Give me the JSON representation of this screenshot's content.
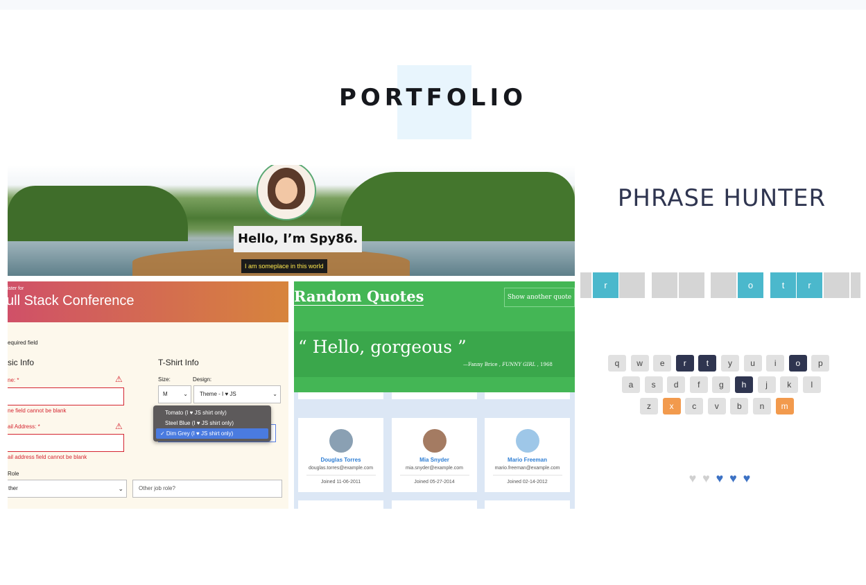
{
  "page": {
    "title": "PORTFOLIO"
  },
  "hero": {
    "greeting": "Hello, I’m Spy86.",
    "tagline": "I am someplace in this world"
  },
  "conference": {
    "register_for": "ister for",
    "name": "ull Stack Conference",
    "required_note": "equired field",
    "basic_info": "sic Info",
    "tshirt_info": "T-Shirt Info",
    "name_label": "ne: *",
    "name_error": "ne field cannot be blank",
    "email_label": "ail Address: *",
    "email_error": "ail address field cannot be blank",
    "role_label": "Role",
    "role_value": "ther",
    "other_role_placeholder": "Other job role?",
    "size_label": "Size:",
    "size_value": "M",
    "design_label": "Design:",
    "design_value": "Theme - I ♥ JS",
    "color_options": [
      "Tomato (I ♥ JS shirt only)",
      "Steel Blue (I ♥ JS shirt only)",
      "✓ Dim Grey (I ♥ JS shirt only)"
    ],
    "selected_color_index": 2
  },
  "quotes": {
    "title": "Random Quotes",
    "button": "Show another quote",
    "quote": "“ Hello, gorgeous ”",
    "source": "—Fanny Brice ,",
    "citation": "FUNNY GIRL",
    "year": ", 1968"
  },
  "employees": [
    {
      "name": "Douglas Torres",
      "email": "douglas.torres@example.com",
      "joined": "Joined 11-06-2011"
    },
    {
      "name": "Mia Snyder",
      "email": "mia.snyder@example.com",
      "joined": "Joined 05-27-2014"
    },
    {
      "name": "Mario Freeman",
      "email": "mario.freeman@example.com",
      "joined": "Joined 02-14-2012"
    }
  ],
  "phrase_hunter": {
    "title": "PHRASE HUNTER",
    "tiles": [
      "",
      "r",
      "",
      "",
      "",
      "",
      "o",
      "t",
      "r",
      "",
      ""
    ],
    "keyboard_rows": [
      [
        "q",
        "w",
        "e",
        "r",
        "t",
        "y",
        "u",
        "i",
        "o",
        "p"
      ],
      [
        "a",
        "s",
        "d",
        "f",
        "g",
        "h",
        "j",
        "k",
        "l"
      ],
      [
        "z",
        "x",
        "c",
        "v",
        "b",
        "n",
        "m"
      ]
    ],
    "chosen_keys": [
      "r",
      "t",
      "o",
      "h"
    ],
    "wrong_keys": [
      "x",
      "m"
    ],
    "lives_lost": 2,
    "lives_total": 5,
    "colors": {
      "chosen": "#2f3550",
      "wrong": "#f29a4d",
      "revealed": "#4bb8cc",
      "heart_full": "#3d72c4",
      "heart_lost": "#d0d0d0"
    }
  }
}
